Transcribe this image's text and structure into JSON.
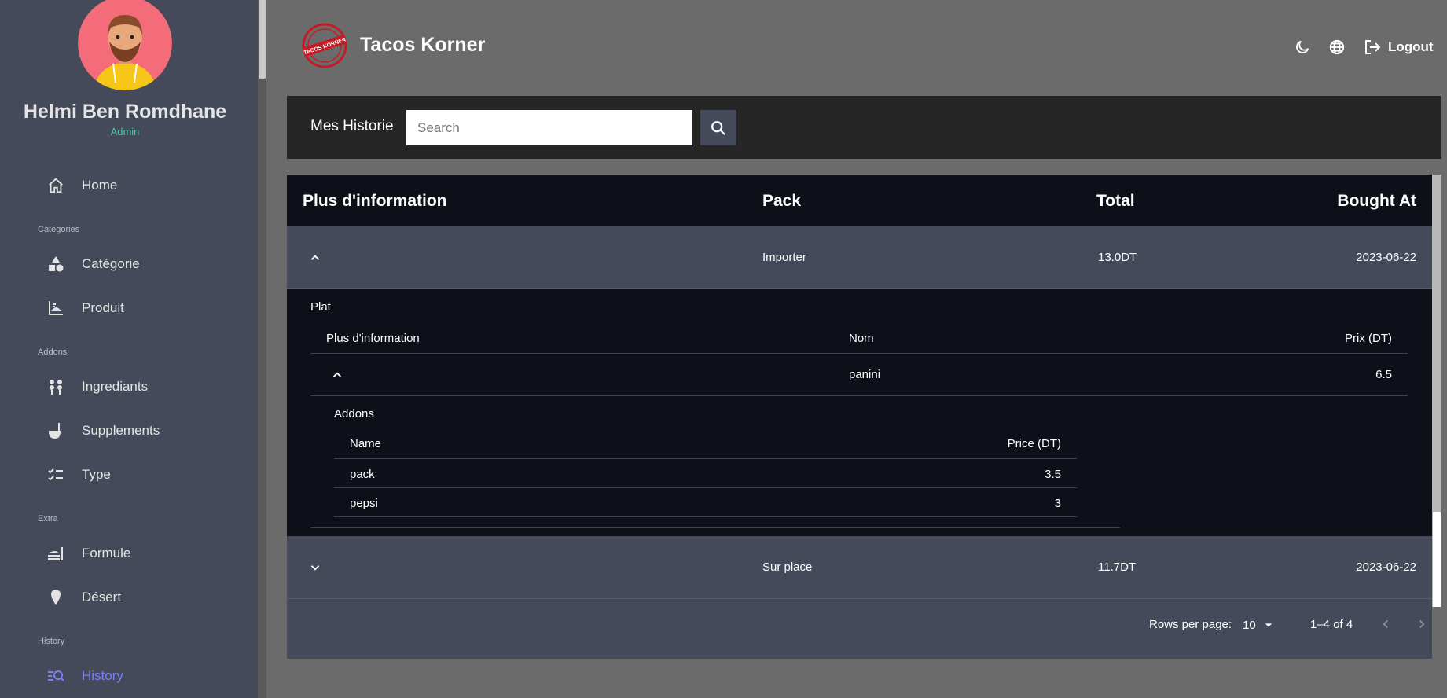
{
  "user": {
    "name": "Helmi Ben Romdhane",
    "role": "Admin"
  },
  "sidebar": {
    "items": [
      {
        "label": "Home",
        "icon": "home-icon"
      },
      {
        "section": "Catégories"
      },
      {
        "label": "Catégorie",
        "icon": "shapes-icon"
      },
      {
        "label": "Produit",
        "icon": "product-icon"
      },
      {
        "section": "Addons"
      },
      {
        "label": "Ingrediants",
        "icon": "ingredients-icon"
      },
      {
        "label": "Supplements",
        "icon": "ladle-icon"
      },
      {
        "label": "Type",
        "icon": "checklist-icon"
      },
      {
        "section": "Extra"
      },
      {
        "label": "Formule",
        "icon": "meal-icon"
      },
      {
        "label": "Désert",
        "icon": "ice-cream-icon"
      },
      {
        "section": "History"
      },
      {
        "label": "History",
        "icon": "history-search-icon",
        "active": true
      }
    ]
  },
  "header": {
    "logo_text": "TACOS KORNER",
    "title": "Tacos Korner",
    "logout_label": "Logout"
  },
  "search": {
    "title": "Mes Historie",
    "placeholder": "Search",
    "value": ""
  },
  "table": {
    "headers": [
      "Plus d'information",
      "Pack",
      "Total",
      "Bought At"
    ],
    "rows": [
      {
        "pack": "Importer",
        "total": "13.0DT",
        "bought_at": "2023-06-22",
        "expanded": true,
        "plat": {
          "title": "Plat",
          "headers": [
            "Plus d'information",
            "Nom",
            "Prix (DT)"
          ],
          "rows": [
            {
              "nom": "panini",
              "prix": "6.5",
              "addons": {
                "title": "Addons",
                "headers": [
                  "Name",
                  "Price (DT)"
                ],
                "rows": [
                  {
                    "name": "pack",
                    "price": "3.5"
                  },
                  {
                    "name": "pepsi",
                    "price": "3"
                  }
                ]
              }
            }
          ]
        }
      },
      {
        "pack": "Sur place",
        "total": "11.7DT",
        "bought_at": "2023-06-22",
        "expanded": false
      }
    ]
  },
  "pagination": {
    "rows_per_page_label": "Rows per page:",
    "rows_per_page": "10",
    "range": "1–4 of 4"
  },
  "colors": {
    "sidebar": "#444a59",
    "page_bg": "#6b6b6b",
    "table_head": "#0d1018",
    "accent": "#7b7ff5",
    "role": "#4cc9a6"
  }
}
